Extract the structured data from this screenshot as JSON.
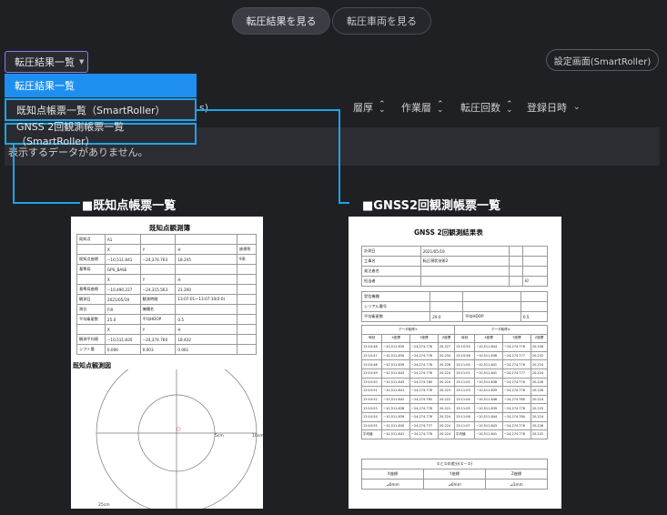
{
  "top_tabs": [
    "転圧結果を見る",
    "転圧車両を見る"
  ],
  "dropdown": {
    "label": "転圧結果一覧",
    "caret": "▼"
  },
  "settings_button": "設定画面(SmartRoller)",
  "menu": [
    "転圧結果一覧",
    "既知点帳票一覧（SmartRoller）",
    "GNSS 2回観測帳票一覧（SmartRoller）"
  ],
  "table": {
    "sort_fragment": "s)",
    "headers": [
      "層厚",
      "作業層",
      "転圧回数",
      "登録日時"
    ],
    "empty_message": "表示するデータがありません。"
  },
  "sections": {
    "known_point": "■既知点帳票一覧",
    "gnss": "■GNSS2回観測帳票一覧"
  },
  "known_point_report": {
    "title": "既知点観測簿",
    "rows": [
      [
        "既知点",
        "A1",
        "",
        "",
        ""
      ],
      [
        "",
        "X",
        "Y",
        "H",
        "座標系"
      ],
      [
        "既知点座標",
        "−10,511.841",
        "−24,374.763",
        "18.245",
        "9系"
      ],
      [
        "基準局",
        "GPS_BASE",
        "",
        "",
        ""
      ],
      [
        "",
        "X",
        "Y",
        "H",
        ""
      ],
      [
        "基準局座標",
        "−10,490.227",
        "−24,315.563",
        "21.200",
        ""
      ],
      [
        "観測日",
        "2021/05/19",
        "観測時間",
        "13:07:01〜13:07:10(0:0)",
        ""
      ],
      [
        "測位",
        "FIX",
        "機種名",
        "",
        ""
      ],
      [
        "平均衛星数",
        "25.0",
        "平均HDOP",
        "0.5",
        ""
      ],
      [
        "",
        "X",
        "Y",
        "H",
        ""
      ],
      [
        "観測平均値",
        "−10,511.835",
        "−24,374.760",
        "18.432",
        ""
      ],
      [
        "シフト量",
        "0.006",
        "0.003",
        "0.061",
        ""
      ]
    ],
    "chart_title": "既知点観測図",
    "ring_labels": [
      "5cm",
      "10cm",
      "25cm"
    ],
    "point_marker": "○"
  },
  "gnss_report": {
    "title": "GNSS 2回観測結果表",
    "info_rows": [
      [
        "計測日",
        "2021/05/19",
        "",
        ""
      ],
      [
        "工事名",
        "転圧現状技術2",
        "",
        ""
      ],
      [
        "発注者名",
        "",
        "",
        ""
      ],
      [
        "担当者",
        "",
        "",
        "印"
      ]
    ],
    "equip_rows": [
      [
        "受信機種",
        "",
        "",
        ""
      ],
      [
        "シリアル番号",
        "",
        "",
        ""
      ],
      [
        "平均衛星数",
        "29.0",
        "平均HDOP",
        "0.5"
      ]
    ],
    "obs_headers": [
      "データ取得①",
      "データ取得②"
    ],
    "obs_col_headers": [
      "時刻",
      "X座標",
      "Y座標",
      "Z座標",
      "時刻",
      "X座標",
      "Y座標",
      "Z座標"
    ],
    "obs_rows": [
      [
        "13:10:46",
        "−10,511.839",
        "−24,274.776",
        "20.227",
        "13:10:55",
        "−10,511.844",
        "−24,274.776",
        "20.226"
      ],
      [
        "13:10:47",
        "−10,511.830",
        "−24,274.776",
        "20.234",
        "13:10:56",
        "−10,511.838",
        "−24,274.777",
        "20.232"
      ],
      [
        "13:10:48",
        "−10,511.839",
        "−24,274.776",
        "20.226",
        "13:11:00",
        "−10,511.841",
        "−24,274.776",
        "20.224"
      ],
      [
        "13:10:49",
        "−10,511.843",
        "−24,274.776",
        "20.224",
        "13:11:01",
        "−10,511.841",
        "−24,274.777",
        "20.224"
      ],
      [
        "13:10:50",
        "−10,511.843",
        "−24,274.780",
        "20.224",
        "13:11:02",
        "−10,511.838",
        "−24,274.776",
        "20.226"
      ],
      [
        "13:10:51",
        "−10,511.841",
        "−24,274.776",
        "20.223",
        "13:11:03",
        "−10,511.839",
        "−24,274.776",
        "20.226"
      ],
      [
        "13:10:52",
        "−10,511.842",
        "−24,274.782",
        "20.222",
        "13:11:04",
        "−10,511.846",
        "−24,274.780",
        "20.224"
      ],
      [
        "13:10:53",
        "−10,511.838",
        "−24,274.776",
        "20.221",
        "13:11:05",
        "−10,511.839",
        "−24,274.778",
        "20.225"
      ],
      [
        "13:10:54",
        "−10,511.839",
        "−24,274.776",
        "20.224",
        "13:11:06",
        "−10,511.844",
        "−24,274.780",
        "20.224"
      ],
      [
        "13:10:55",
        "−10,511.840",
        "−24,274.777",
        "20.224",
        "13:11:07",
        "−10,511.843",
        "−24,274.776",
        "20.226"
      ],
      [
        "平均値",
        "−10,511.841",
        "−24,274.778",
        "20.224",
        "平均値",
        "−10,511.841",
        "−24,274.778",
        "20.222"
      ]
    ],
    "diff_title": "①と②の差分(①－②)",
    "diff_headers": [
      "X座標",
      "Y座標",
      "Z座標"
    ],
    "diff_values": [
      "⊿0mm",
      "⊿0mm",
      "⊿1mm"
    ]
  }
}
